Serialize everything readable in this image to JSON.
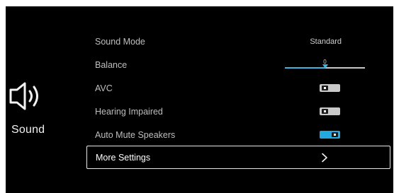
{
  "side_panel": {
    "icon": "speaker-icon",
    "title": "Sound"
  },
  "menu": {
    "items": [
      {
        "label": "Sound Mode",
        "value": "Standard"
      },
      {
        "label": "Balance",
        "value": "0",
        "level": 0.5
      },
      {
        "label": "AVC",
        "state": "off"
      },
      {
        "label": "Hearing Impaired",
        "state": "off"
      },
      {
        "label": "Auto Mute Speakers",
        "state": "on"
      },
      {
        "label": "More Settings",
        "icon": "chevron-right-icon",
        "selected": true
      }
    ]
  },
  "colors": {
    "accent": "#24a8e0",
    "background": "#000000",
    "text": "#bfbfbf"
  }
}
